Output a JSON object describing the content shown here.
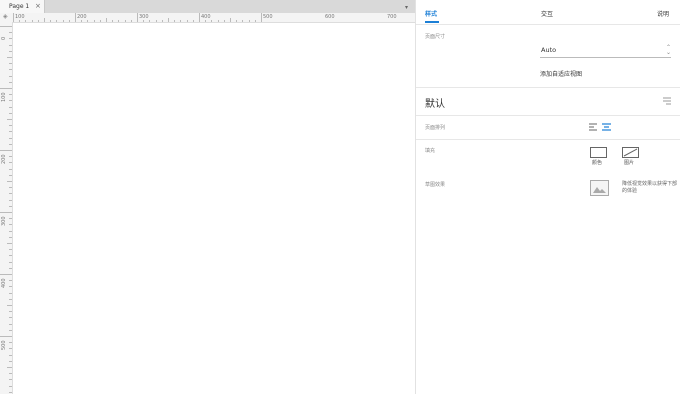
{
  "tabs": {
    "page_tab_label": "Page 1",
    "close_glyph": "×",
    "dropdown_glyph": "▾"
  },
  "ruler": {
    "corner_glyph": "◈",
    "h_labels": [
      "100",
      "200",
      "300",
      "400",
      "500",
      "600",
      "700"
    ],
    "v_labels": [
      "0",
      "100",
      "200",
      "300",
      "400",
      "500"
    ]
  },
  "panel": {
    "tabs": {
      "style": "样式",
      "interact": "交互",
      "notes": "说明"
    },
    "page_size_label": "页面尺寸",
    "page_size_value": "Auto",
    "add_adaptive_view": "添加自适应视图",
    "section_title": "默认",
    "page_align_label": "页面排列",
    "fill_label": "填充",
    "fill_color_label": "颜色",
    "fill_image_label": "图片",
    "low_fidelity_label": "草图效果",
    "low_fidelity_text": "降低视觉效果以获得下部的体验"
  },
  "colors": {
    "accent": "#1c7fd6"
  }
}
